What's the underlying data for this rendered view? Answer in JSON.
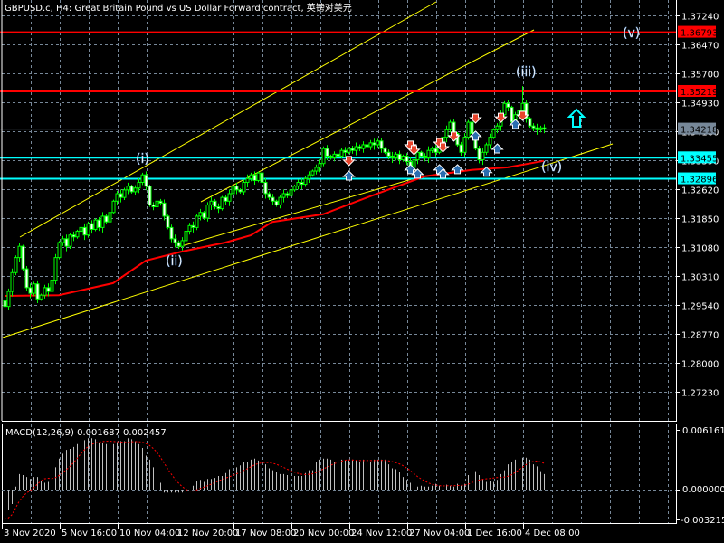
{
  "header": {
    "title": "GBPUSD.c, H4:  Great Britain Pound vs US Dollar Forward contract, 英镑对美元"
  },
  "price_axis": {
    "ticks": [
      "1.37240",
      "1.36470",
      "1.35700",
      "1.34930",
      "1.34160",
      "1.33390",
      "1.32620",
      "1.31850",
      "1.31080",
      "1.30310",
      "1.29540",
      "1.28770",
      "1.28000",
      "1.27230"
    ]
  },
  "levels": [
    {
      "price": "1.36793",
      "color": "#ff0000",
      "text_color": "#000000"
    },
    {
      "price": "1.35219",
      "color": "#ff0000",
      "text_color": "#000000"
    },
    {
      "price": "1.34218",
      "color": "#778899",
      "text_color": "#000000"
    },
    {
      "price": "1.33455",
      "color": "#00ffff",
      "text_color": "#000000"
    },
    {
      "price": "1.32896",
      "color": "#00ffff",
      "text_color": "#000000"
    }
  ],
  "time_axis": {
    "labels": [
      "3 Nov 2020",
      "5 Nov 16:00",
      "10 Nov 04:00",
      "12 Nov 20:00",
      "17 Nov 08:00",
      "20 Nov 00:00",
      "24 Nov 12:00",
      "27 Nov 04:00",
      "1 Dec 16:00",
      "4 Dec 08:00"
    ]
  },
  "wave_labels": {
    "w1": "(i)",
    "w2": "(ii)",
    "w3": "(iii)",
    "w4": "(iv)",
    "w5": "(v)"
  },
  "macd": {
    "label": "MACD(12,26,9) 0.001687 0.002457",
    "scale_top": "0.006161",
    "scale_zero": "0.000000",
    "scale_bottom": "-0.003215"
  },
  "colors": {
    "candle": "#00ff00",
    "ma": "#ff0000",
    "trend": "#ffff00",
    "grid": "#778899",
    "hist": "#c0c0c0",
    "signal": "#ff0000",
    "arrow": "#00ffff",
    "sell": "#e8442c",
    "buy": "#2a6db0"
  },
  "chart_data": {
    "type": "candlestick",
    "symbol": "GBPUSD.c",
    "timeframe": "H4",
    "ylim": [
      1.27,
      1.374
    ],
    "closes": [
      1.295,
      1.299,
      1.304,
      1.308,
      1.311,
      1.305,
      1.3,
      1.2985,
      1.301,
      1.297,
      1.298,
      1.3,
      1.299,
      1.302,
      1.308,
      1.312,
      1.313,
      1.311,
      1.314,
      1.3135,
      1.315,
      1.316,
      1.314,
      1.317,
      1.3155,
      1.318,
      1.316,
      1.319,
      1.3175,
      1.32,
      1.323,
      1.325,
      1.324,
      1.326,
      1.327,
      1.3255,
      1.3265,
      1.328,
      1.33,
      1.327,
      1.322,
      1.3215,
      1.323,
      1.3225,
      1.319,
      1.316,
      1.313,
      1.312,
      1.311,
      1.3125,
      1.315,
      1.3165,
      1.316,
      1.319,
      1.32,
      1.3185,
      1.322,
      1.323,
      1.3215,
      1.321,
      1.324,
      1.323,
      1.325,
      1.327,
      1.326,
      1.3255,
      1.328,
      1.329,
      1.33,
      1.3285,
      1.3305,
      1.328,
      1.325,
      1.324,
      1.323,
      1.322,
      1.324,
      1.325,
      1.3245,
      1.326,
      1.327,
      1.328,
      1.3275,
      1.329,
      1.33,
      1.331,
      1.332,
      1.333,
      1.337,
      1.335,
      1.3345,
      1.3355,
      1.335,
      1.3365,
      1.336,
      1.337,
      1.3365,
      1.3375,
      1.337,
      1.338,
      1.3375,
      1.3385,
      1.338,
      1.339,
      1.337,
      1.336,
      1.335,
      1.3345,
      1.3355,
      1.334,
      1.335,
      1.3335,
      1.332,
      1.334,
      1.336,
      1.335,
      1.3345,
      1.3365,
      1.337,
      1.336,
      1.338,
      1.34,
      1.342,
      1.344,
      1.341,
      1.338,
      1.336,
      1.34,
      1.344,
      1.341,
      1.337,
      1.334,
      1.336,
      1.338,
      1.34,
      1.342,
      1.343,
      1.346,
      1.349,
      1.348,
      1.344,
      1.346,
      1.347,
      1.349,
      1.345,
      1.343,
      1.3425,
      1.342,
      1.3425,
      1.3422
    ],
    "high_overrides": [
      {
        "i": 143,
        "high": 1.3536
      }
    ],
    "moving_average": [
      [
        0,
        1.2978
      ],
      [
        15,
        1.298
      ],
      [
        30,
        1.3012
      ],
      [
        39,
        1.3072
      ],
      [
        49,
        1.3096
      ],
      [
        61,
        1.312
      ],
      [
        68,
        1.3139
      ],
      [
        74,
        1.3175
      ],
      [
        88,
        1.3195
      ],
      [
        101,
        1.3243
      ],
      [
        116,
        1.3296
      ],
      [
        129,
        1.3313
      ],
      [
        139,
        1.332
      ],
      [
        149,
        1.3337
      ]
    ],
    "signals": [
      {
        "i": 95,
        "type": "sell",
        "price": 1.3332
      },
      {
        "i": 95,
        "type": "buy",
        "price": 1.3303
      },
      {
        "i": 112,
        "type": "sell",
        "price": 1.3373
      },
      {
        "i": 113,
        "type": "sell",
        "price": 1.3361
      },
      {
        "i": 112,
        "type": "buy",
        "price": 1.332
      },
      {
        "i": 114,
        "type": "buy",
        "price": 1.3308
      },
      {
        "i": 120,
        "type": "sell",
        "price": 1.338
      },
      {
        "i": 121,
        "type": "sell",
        "price": 1.3368
      },
      {
        "i": 120,
        "type": "buy",
        "price": 1.332
      },
      {
        "i": 121,
        "type": "buy",
        "price": 1.3308
      },
      {
        "i": 124,
        "type": "sell",
        "price": 1.3397
      },
      {
        "i": 125,
        "type": "buy",
        "price": 1.332
      },
      {
        "i": 130,
        "type": "sell",
        "price": 1.3445
      },
      {
        "i": 130,
        "type": "buy",
        "price": 1.3409
      },
      {
        "i": 133,
        "type": "buy",
        "price": 1.3313
      },
      {
        "i": 136,
        "type": "buy",
        "price": 1.3375
      },
      {
        "i": 137,
        "type": "sell",
        "price": 1.3447
      },
      {
        "i": 141,
        "type": "buy",
        "price": 1.344
      },
      {
        "i": 143,
        "type": "sell",
        "price": 1.3452
      }
    ],
    "macd_x1e4": [
      -21,
      -21,
      -15,
      3,
      16,
      15,
      13,
      11,
      13,
      13,
      9,
      7,
      8,
      13,
      23,
      32,
      37,
      41,
      42,
      44,
      47,
      50,
      51,
      53,
      53,
      52,
      48,
      48,
      47,
      48,
      47,
      49,
      50,
      50,
      53,
      52,
      50,
      47,
      43,
      35,
      31,
      23,
      17,
      7,
      -3,
      -3,
      -3,
      -3,
      -3,
      -3,
      -1,
      0,
      4,
      9,
      10,
      8,
      11,
      11,
      12,
      14,
      14,
      17,
      21,
      22,
      23,
      25,
      28,
      29,
      31,
      32,
      30,
      28,
      26,
      22,
      20,
      18,
      16,
      16,
      15,
      16,
      14,
      14,
      14,
      17,
      20,
      20,
      28,
      31,
      32,
      32,
      31,
      29,
      29,
      31,
      30,
      30,
      31,
      30,
      29,
      31,
      29,
      29,
      31,
      31,
      31,
      31,
      26,
      22,
      21,
      18,
      13,
      10,
      7,
      3,
      3,
      4,
      3,
      3,
      4,
      6,
      4,
      3,
      5,
      4,
      3,
      6,
      4,
      6,
      15,
      16,
      19,
      15,
      11,
      8,
      9,
      8,
      10,
      16,
      20,
      26,
      29,
      31,
      32,
      33,
      33,
      31,
      26,
      24,
      19,
      16
    ],
    "macd_params": "12,26,9"
  }
}
